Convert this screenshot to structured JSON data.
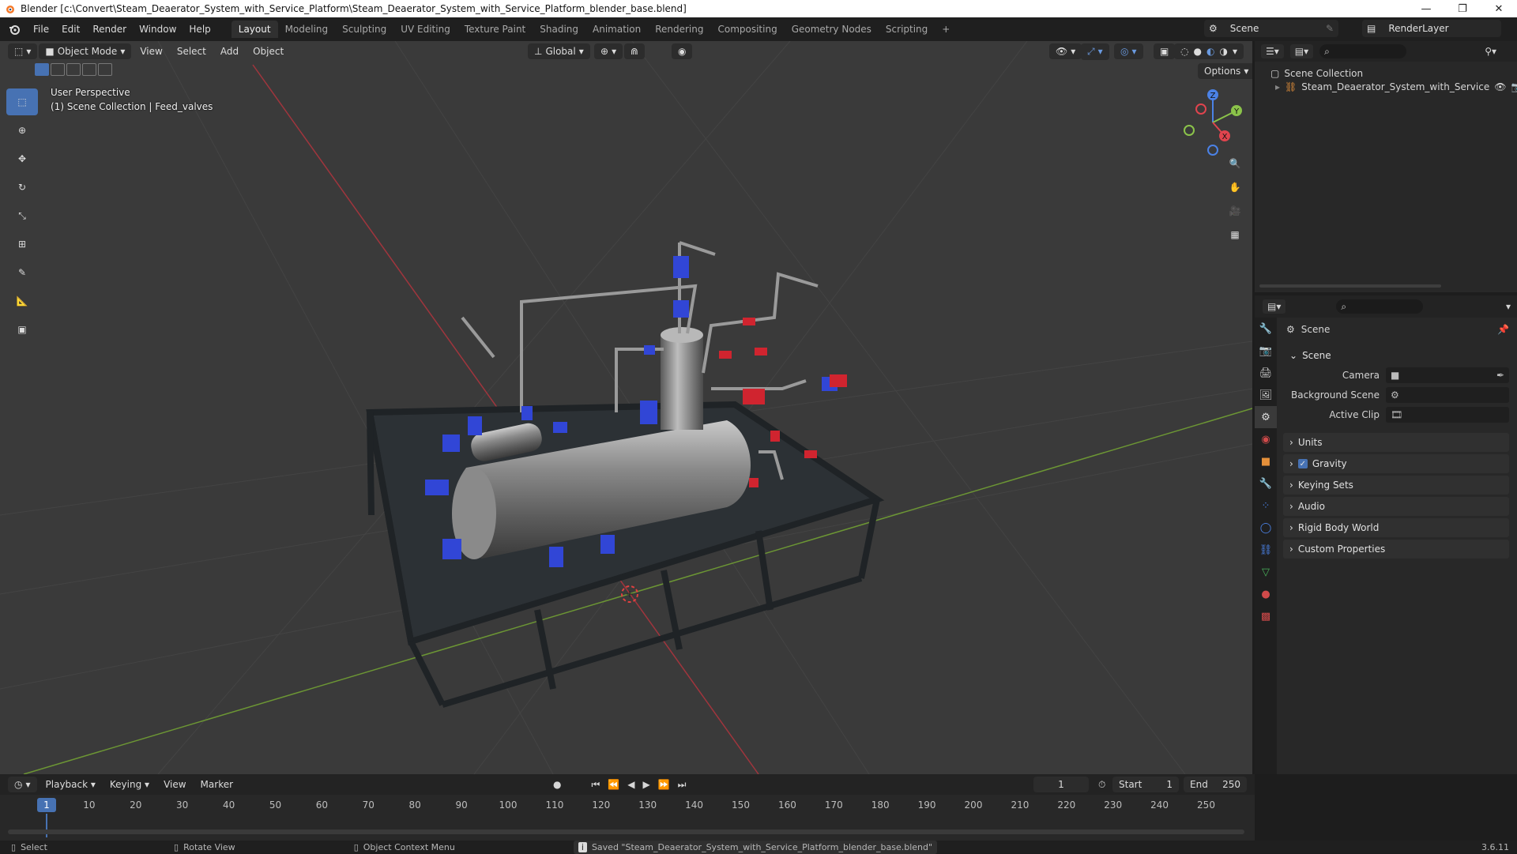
{
  "window": {
    "title": "Blender [c:\\Convert\\Steam_Deaerator_System_with_Service_Platform\\Steam_Deaerator_System_with_Service_Platform_blender_base.blend]",
    "minimize": "—",
    "maximize": "❐",
    "close": "✕"
  },
  "menu": [
    "File",
    "Edit",
    "Render",
    "Window",
    "Help"
  ],
  "workspaces": [
    "Layout",
    "Modeling",
    "Sculpting",
    "UV Editing",
    "Texture Paint",
    "Shading",
    "Animation",
    "Rendering",
    "Compositing",
    "Geometry Nodes",
    "Scripting"
  ],
  "active_workspace": "Layout",
  "add_workspace": "+",
  "scene_selector": {
    "value": "Scene"
  },
  "renderlayer_selector": {
    "value": "RenderLayer"
  },
  "viewport": {
    "mode": "Object Mode",
    "menus": [
      "View",
      "Select",
      "Add",
      "Object"
    ],
    "transform_orientation": "Global",
    "options_label": "Options",
    "perspective_label": "User Perspective",
    "collection_label": "(1) Scene Collection | Feed_valves",
    "gizmo": {
      "x": "X",
      "y": "Y",
      "z": "Z"
    }
  },
  "outliner": {
    "root": "Scene Collection",
    "items": [
      "Steam_Deaerator_System_with_Service"
    ]
  },
  "properties": {
    "header": "Scene",
    "section": "Scene",
    "fields": [
      {
        "label": "Camera",
        "value": ""
      },
      {
        "label": "Background Scene",
        "value": ""
      },
      {
        "label": "Active Clip",
        "value": ""
      }
    ],
    "panels": [
      "Units",
      "Gravity",
      "Keying Sets",
      "Audio",
      "Rigid Body World",
      "Custom Properties"
    ],
    "gravity_checked": true
  },
  "timeline": {
    "menus": [
      "Playback",
      "Keying",
      "View",
      "Marker"
    ],
    "current_frame": "1",
    "start_label": "Start",
    "start": "1",
    "end_label": "End",
    "end": "250",
    "ticks": [
      "10",
      "20",
      "30",
      "40",
      "50",
      "60",
      "70",
      "80",
      "90",
      "100",
      "110",
      "120",
      "130",
      "140",
      "150",
      "160",
      "170",
      "180",
      "190",
      "200",
      "210",
      "220",
      "230",
      "240",
      "250"
    ],
    "playhead": "1"
  },
  "statusbar": {
    "select": "Select",
    "rotate": "Rotate View",
    "context": "Object Context Menu",
    "message": "Saved \"Steam_Deaerator_System_with_Service_Platform_blender_base.blend\"",
    "version": "3.6.11"
  },
  "colors": {
    "accent": "#4772b3",
    "viewport_bg": "#3a3a3a",
    "x_axis": "#e0444e",
    "y_axis": "#8bc34a",
    "z_axis": "#4b82e6"
  }
}
